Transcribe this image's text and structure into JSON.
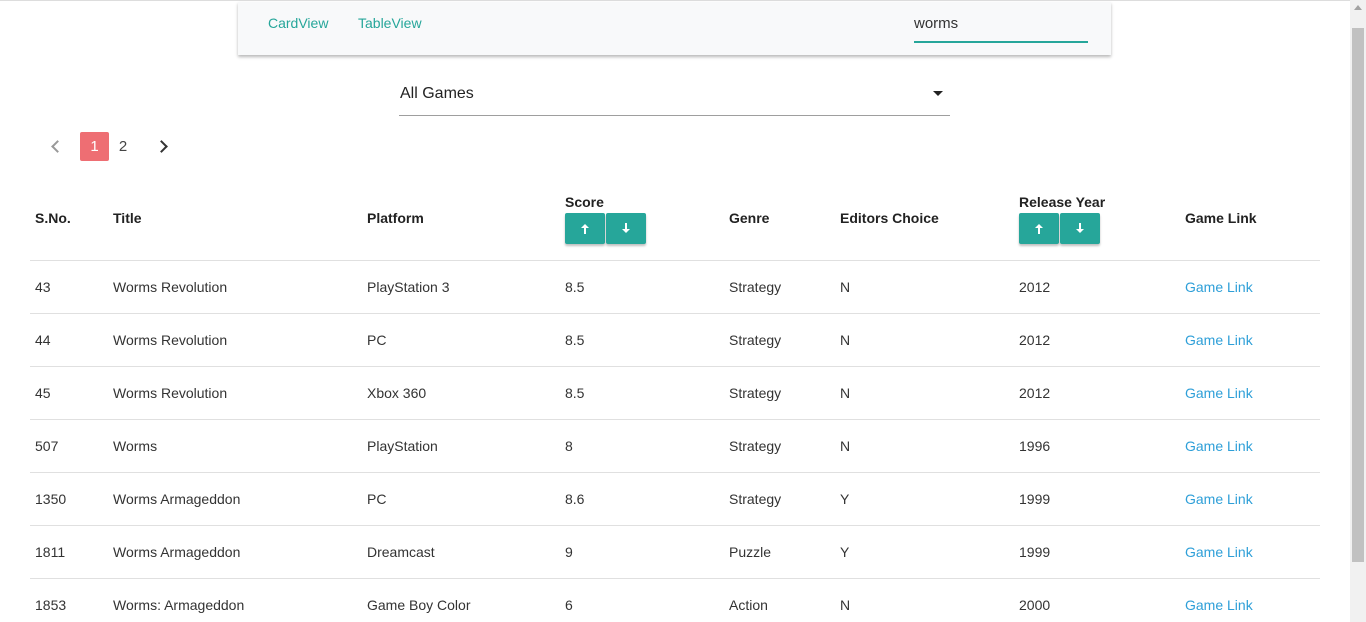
{
  "nav": {
    "tabs": [
      {
        "label": "CardView"
      },
      {
        "label": "TableView"
      }
    ],
    "search_value": "worms"
  },
  "filter": {
    "selected": "All Games"
  },
  "pagination": {
    "pages": [
      "1",
      "2"
    ],
    "active": "1"
  },
  "table": {
    "headers": {
      "sno": "S.No.",
      "title": "Title",
      "platform": "Platform",
      "score": "Score",
      "genre": "Genre",
      "editors_choice": "Editors Choice",
      "release_year": "Release Year",
      "game_link": "Game Link"
    },
    "rows": [
      {
        "sno": "43",
        "title": "Worms Revolution",
        "platform": "PlayStation 3",
        "score": "8.5",
        "genre": "Strategy",
        "editors_choice": "N",
        "year": "2012",
        "link": "Game Link"
      },
      {
        "sno": "44",
        "title": "Worms Revolution",
        "platform": "PC",
        "score": "8.5",
        "genre": "Strategy",
        "editors_choice": "N",
        "year": "2012",
        "link": "Game Link"
      },
      {
        "sno": "45",
        "title": "Worms Revolution",
        "platform": "Xbox 360",
        "score": "8.5",
        "genre": "Strategy",
        "editors_choice": "N",
        "year": "2012",
        "link": "Game Link"
      },
      {
        "sno": "507",
        "title": "Worms",
        "platform": "PlayStation",
        "score": "8",
        "genre": "Strategy",
        "editors_choice": "N",
        "year": "1996",
        "link": "Game Link"
      },
      {
        "sno": "1350",
        "title": "Worms Armageddon",
        "platform": "PC",
        "score": "8.6",
        "genre": "Strategy",
        "editors_choice": "Y",
        "year": "1999",
        "link": "Game Link"
      },
      {
        "sno": "1811",
        "title": "Worms Armageddon",
        "platform": "Dreamcast",
        "score": "9",
        "genre": "Puzzle",
        "editors_choice": "Y",
        "year": "1999",
        "link": "Game Link"
      },
      {
        "sno": "1853",
        "title": "Worms: Armageddon",
        "platform": "Game Boy Color",
        "score": "6",
        "genre": "Action",
        "editors_choice": "N",
        "year": "2000",
        "link": "Game Link"
      }
    ]
  },
  "colors": {
    "accent": "#26a69a",
    "active_page": "#ee6e73",
    "link": "#2e9fd8"
  }
}
